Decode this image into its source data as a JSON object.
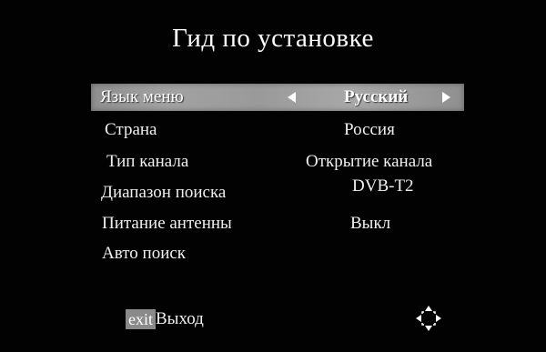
{
  "title": "Гид по установке",
  "menu": [
    {
      "label": "Язык меню",
      "value": "Русский",
      "selected": true
    },
    {
      "label": "Страна",
      "value": "Россия",
      "selected": false
    },
    {
      "label": "Тип канала",
      "value": "Открытие канала",
      "selected": false
    },
    {
      "label": "Диапазон поиска",
      "value": "DVB-T2",
      "selected": false
    },
    {
      "label": "Питание антенны",
      "value": "Выкл",
      "selected": false
    },
    {
      "label": "Авто поиск",
      "value": "",
      "selected": false
    }
  ],
  "footer": {
    "exit_badge": "exit",
    "exit_label": "Выход",
    "nav_icon": "navigation-arrows-icon"
  },
  "colors": {
    "background": "#020202",
    "text": "#f0f0f0",
    "highlight": "#9a9a9a",
    "exit_badge": "#8a8a8a"
  }
}
